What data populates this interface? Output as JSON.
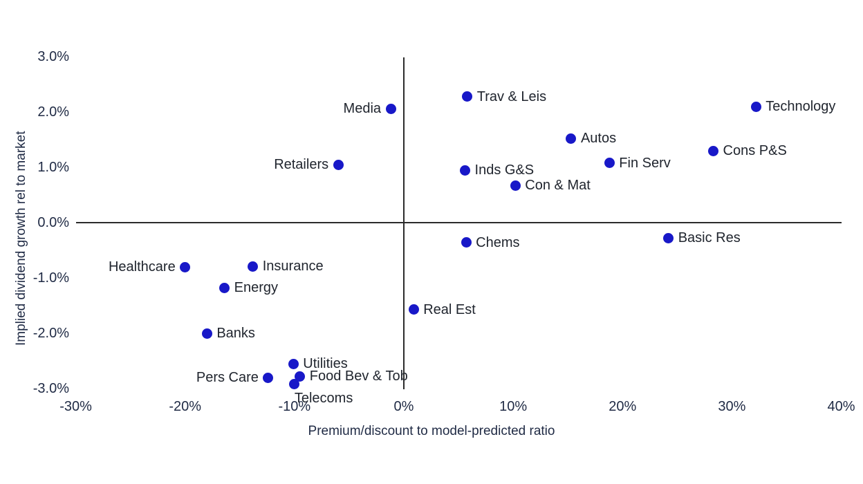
{
  "chart_data": {
    "type": "scatter",
    "title": "",
    "xlabel": "Premium/discount to model-predicted ratio",
    "ylabel": "Implied dividend growth rel to market",
    "xlim": [
      -30,
      40
    ],
    "ylim": [
      -3.0,
      3.0
    ],
    "xticks": [
      "-30%",
      "-20%",
      "-10%",
      "0%",
      "10%",
      "20%",
      "30%",
      "40%"
    ],
    "xtick_values": [
      -30,
      -20,
      -10,
      0,
      10,
      20,
      30,
      40
    ],
    "yticks": [
      "3.0%",
      "2.0%",
      "1.0%",
      "0.0%",
      "-1.0%",
      "-2.0%",
      "-3.0%"
    ],
    "ytick_values": [
      3.0,
      2.0,
      1.0,
      0.0,
      -1.0,
      -2.0,
      -3.0
    ],
    "grid": false,
    "legend": "none",
    "marker_color": "#1818c8",
    "axis_color": "#2b2b2b",
    "points": [
      {
        "label": "Trav & Leis",
        "x": 5.8,
        "y": 2.28,
        "label_side": "right"
      },
      {
        "label": "Technology",
        "x": 32.2,
        "y": 2.1,
        "label_side": "right"
      },
      {
        "label": "Media",
        "x": -1.2,
        "y": 2.06,
        "label_side": "left"
      },
      {
        "label": "Autos",
        "x": 15.3,
        "y": 1.52,
        "label_side": "right"
      },
      {
        "label": "Cons P&S",
        "x": 28.3,
        "y": 1.3,
        "label_side": "right"
      },
      {
        "label": "Fin Serv",
        "x": 18.8,
        "y": 1.08,
        "label_side": "right"
      },
      {
        "label": "Retailers",
        "x": -6.0,
        "y": 1.05,
        "label_side": "left"
      },
      {
        "label": "Inds G&S",
        "x": 5.6,
        "y": 0.95,
        "label_side": "right"
      },
      {
        "label": "Con & Mat",
        "x": 10.2,
        "y": 0.67,
        "label_side": "right"
      },
      {
        "label": "Basic Res",
        "x": 24.2,
        "y": -0.28,
        "label_side": "right"
      },
      {
        "label": "Chems",
        "x": 5.7,
        "y": -0.36,
        "label_side": "right"
      },
      {
        "label": "Insurance",
        "x": -13.8,
        "y": -0.79,
        "label_side": "right"
      },
      {
        "label": "Healthcare",
        "x": -20.0,
        "y": -0.8,
        "label_side": "left"
      },
      {
        "label": "Energy",
        "x": -16.4,
        "y": -1.18,
        "label_side": "right"
      },
      {
        "label": "Real Est",
        "x": 0.9,
        "y": -1.57,
        "label_side": "right"
      },
      {
        "label": "Banks",
        "x": -18.0,
        "y": -2.0,
        "label_side": "right"
      },
      {
        "label": "Utilities",
        "x": -10.1,
        "y": -2.55,
        "label_side": "right"
      },
      {
        "label": "Pers Care",
        "x": -12.4,
        "y": -2.8,
        "label_side": "left"
      },
      {
        "label": "Food Bev & Tob",
        "x": -9.5,
        "y": -2.78,
        "label_side": "right"
      },
      {
        "label": "Telecoms",
        "x": -10.0,
        "y": -2.92,
        "label_side": "below"
      }
    ]
  }
}
